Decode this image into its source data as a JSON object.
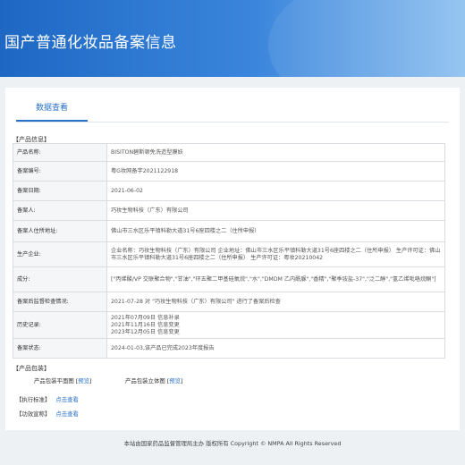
{
  "page_title": "国产普通化妆品备案信息",
  "tab_label": "数据查看",
  "product_info_title": "【产品信息】",
  "rows": [
    {
      "label": "产品名称:",
      "value": "BISITON碧斯顿免洗造型膜妖"
    },
    {
      "label": "备案编号:",
      "value": "粤G妆网备字2021122918"
    },
    {
      "label": "备案日期:",
      "value": "2021-06-02"
    },
    {
      "label": "备案人:",
      "value": "巧妆生物科技（广东）有限公司"
    },
    {
      "label": "备案人住所地址:",
      "value": "佛山市三水区乐平镇科勒大道31号6座四楼之二（住所申报）"
    },
    {
      "label": "生产企业:",
      "value": "企业名称：巧妆生物科技（广东）有限公司 企业地址：佛山市三水区乐平镇科勒大道31号6座四楼之二（住所申报） 生产许可证：佛山市三水区乐平镇科勒大道31号6座四楼之二（住所申报） 生产许可证：粤妆20210042"
    },
    {
      "label": "成分:",
      "value": "[\"丙烯酸/VP 交联聚合物\",\"甘油\",\"环五聚二甲基硅氧烷\",\"水\",\"DMDM 乙内酰脲\",\"香精\",\"聚季铵盐-37\",\"泛二醇\",\"氢乙烯吡咯烷酮\"]"
    },
    {
      "label": "备案后监督检查情况:",
      "value": "2021-07-28 对 \"巧妆生物科技（广东）有限公司\" 进行了备案后检查"
    },
    {
      "label": "历史记录:",
      "value": "2021年07月09日 信息补录\n2021年11月16日 信息变更\n2023年12月05日 信息变更"
    },
    {
      "label": "备案状态:",
      "value": "2024-01-03,该产品已完成2023年度报告"
    }
  ],
  "package_title": "【产品包装】",
  "package_front_label": "产品包装平面图",
  "package_side_label": "产品包装立体图",
  "preview_link": "预览",
  "standard_title": "【执行标准】",
  "efficacy_title": "【功效宣称】",
  "view_link": "点击查看",
  "footer_text": "本站由国家药品监督管理局主办 版权所有 Copyright © NMPA All Rights Reserved"
}
